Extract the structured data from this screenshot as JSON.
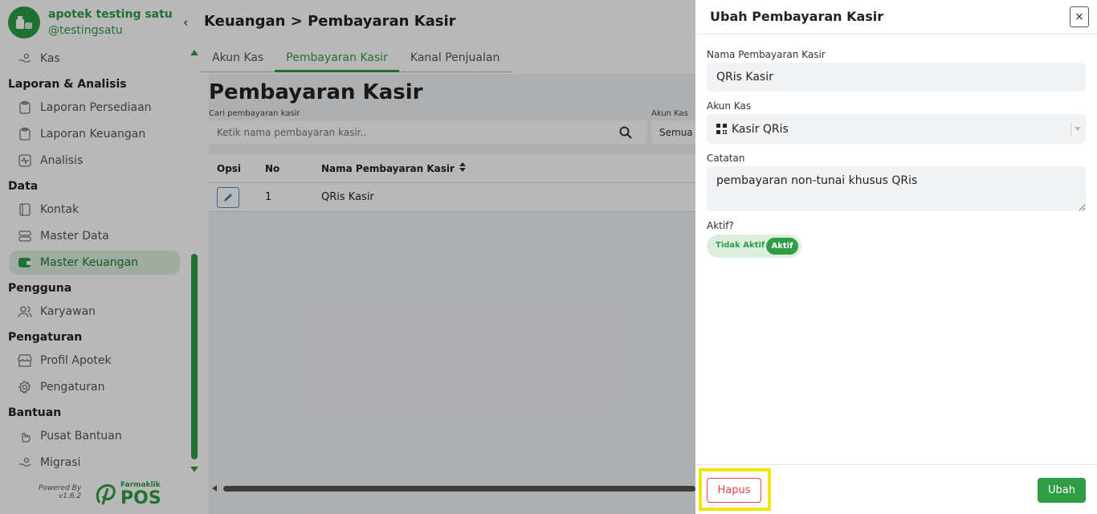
{
  "brand": {
    "name": "apotek testing satu",
    "handle": "@testingsatu"
  },
  "sidebar": {
    "sections": [
      {
        "title": "",
        "items": [
          {
            "label": "Kas",
            "icon": "hand-coins-icon"
          }
        ]
      },
      {
        "title": "Laporan & Analisis",
        "items": [
          {
            "label": "Laporan Persediaan",
            "icon": "clipboard-icon"
          },
          {
            "label": "Laporan Keuangan",
            "icon": "clipboard-icon"
          },
          {
            "label": "Analisis",
            "icon": "activity-icon"
          }
        ]
      },
      {
        "title": "Data",
        "items": [
          {
            "label": "Kontak",
            "icon": "contact-book-icon"
          },
          {
            "label": "Master Data",
            "icon": "database-icon"
          },
          {
            "label": "Master Keuangan",
            "icon": "wallet-icon",
            "active": true
          }
        ]
      },
      {
        "title": "Pengguna",
        "items": [
          {
            "label": "Karyawan",
            "icon": "users-icon"
          }
        ]
      },
      {
        "title": "Pengaturan",
        "items": [
          {
            "label": "Profil Apotek",
            "icon": "store-icon"
          },
          {
            "label": "Pengaturan",
            "icon": "gear-icon"
          }
        ]
      },
      {
        "title": "Bantuan",
        "items": [
          {
            "label": "Pusat Bantuan",
            "icon": "hand-help-icon"
          },
          {
            "label": "Migrasi",
            "icon": "hand-coins-icon"
          }
        ]
      }
    ],
    "powered_by": "Powered By",
    "version": "v1.6.2",
    "pos_brand_small": "Farmaklik",
    "pos_brand_big": "POS"
  },
  "header": {
    "breadcrumb": "Keuangan > Pembayaran Kasir"
  },
  "tabs": [
    {
      "label": "Akun Kas",
      "active": false
    },
    {
      "label": "Pembayaran Kasir",
      "active": true
    },
    {
      "label": "Kanal Penjualan",
      "active": false
    }
  ],
  "content": {
    "title": "Pembayaran Kasir",
    "search_label": "Cari pembayaran kasir",
    "search_placeholder": "Ketik nama pembayaran kasir..",
    "akun_label": "Akun Kas",
    "akun_value": "Semua",
    "table": {
      "headers": {
        "opsi": "Opsi",
        "no": "No",
        "name": "Nama Pembayaran Kasir"
      },
      "rows": [
        {
          "no": "1",
          "name": "QRis Kasir"
        }
      ]
    }
  },
  "drawer": {
    "title": "Ubah Pembayaran Kasir",
    "close": "×",
    "name_label": "Nama Pembayaran Kasir",
    "name_value": "QRis Kasir",
    "akun_label": "Akun Kas",
    "akun_value": "Kasir QRis",
    "note_label": "Catatan",
    "note_value": "pembayaran non-tunai khusus QRis",
    "active_label": "Aktif?",
    "toggle_off": "Tidak Aktif",
    "toggle_on": "Aktif",
    "delete_label": "Hapus",
    "submit_label": "Ubah"
  },
  "colors": {
    "brand_green": "#2f9d46",
    "danger": "#e04848",
    "highlight": "#f2e600"
  }
}
